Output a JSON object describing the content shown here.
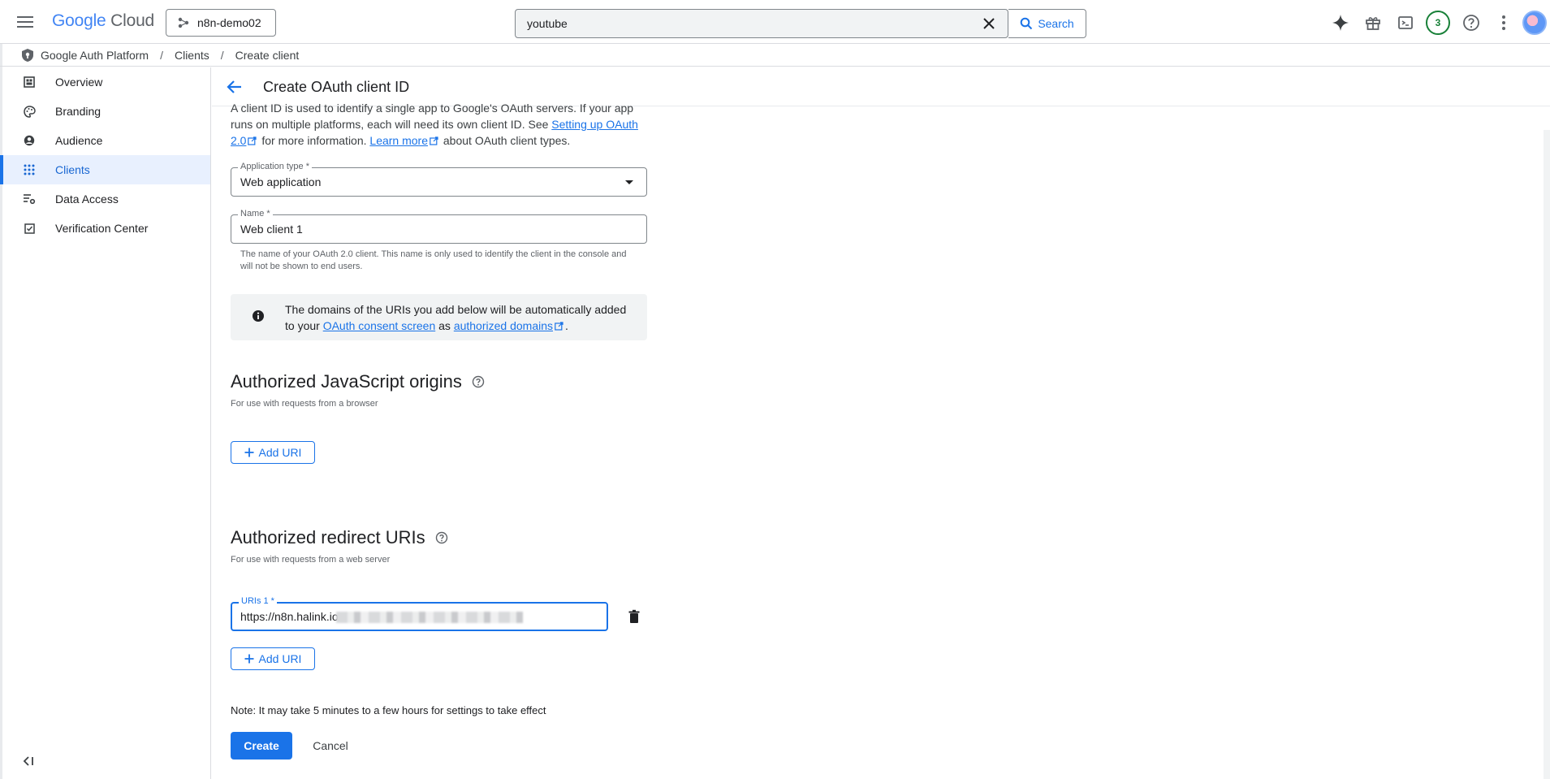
{
  "topbar": {
    "logo_google": "Google",
    "logo_cloud": "Cloud",
    "project": "n8n-demo02",
    "search_value": "youtube",
    "search_button": "Search",
    "notification_count": "3"
  },
  "breadcrumb": {
    "items": [
      "Google Auth Platform",
      "Clients",
      "Create client"
    ],
    "separator": "/"
  },
  "sidebar": {
    "items": [
      {
        "label": "Overview",
        "icon": "dashboard-icon"
      },
      {
        "label": "Branding",
        "icon": "palette-icon"
      },
      {
        "label": "Audience",
        "icon": "person-icon"
      },
      {
        "label": "Clients",
        "icon": "apps-grid-icon",
        "active": true
      },
      {
        "label": "Data Access",
        "icon": "data-access-icon"
      },
      {
        "label": "Verification Center",
        "icon": "checkbox-icon"
      }
    ]
  },
  "page": {
    "title": "Create OAuth client ID",
    "intro_1": "A client ID is used to identify a single app to Google's OAuth servers. If your app runs on multiple platforms, each will need its own client ID. See ",
    "intro_link_1": "Setting up OAuth 2.0",
    "intro_2": " for more information. ",
    "intro_link_2": "Learn more",
    "intro_3": " about OAuth client types."
  },
  "form": {
    "app_type_label": "Application type *",
    "app_type_value": "Web application",
    "name_label": "Name *",
    "name_value": "Web client 1",
    "name_helper": "The name of your OAuth 2.0 client. This name is only used to identify the client in the console and will not be shown to end users.",
    "info_1": "The domains of the URIs you add below will be automatically added to your ",
    "info_link_1": "OAuth consent screen",
    "info_2": " as ",
    "info_link_2": "authorized domains",
    "info_3": "."
  },
  "js_origins": {
    "title": "Authorized JavaScript origins",
    "subtitle": "For use with requests from a browser",
    "add_button": "Add URI"
  },
  "redirect_uris": {
    "title": "Authorized redirect URIs",
    "subtitle": "For use with requests from a web server",
    "uri_label": "URIs 1 *",
    "uri_value": "https://n8n.halink.io",
    "add_button": "Add URI"
  },
  "footer": {
    "note": "Note: It may take 5 minutes to a few hours for settings to take effect",
    "create": "Create",
    "cancel": "Cancel"
  },
  "colors": {
    "accent": "#1a73e8",
    "active_bg": "#e8f0fe",
    "info_bg": "#f1f3f4"
  }
}
